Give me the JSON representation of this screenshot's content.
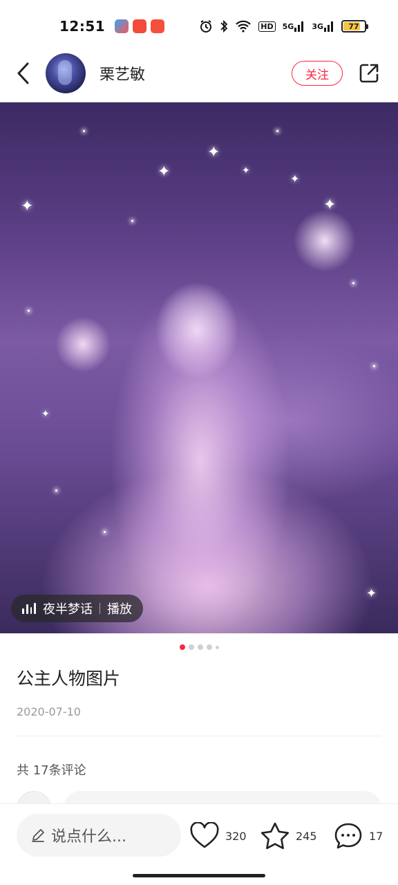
{
  "status_bar": {
    "time": "12:51",
    "network_1": "5G",
    "network_2": "3G",
    "hd_label": "HD",
    "battery_level": "77"
  },
  "header": {
    "author_name": "栗艺敏",
    "follow_label": "关注"
  },
  "media": {
    "music_name": "夜半梦话",
    "play_label": "播放",
    "page_count": 5,
    "active_page": 1
  },
  "note": {
    "title": "公主人物图片",
    "date": "2020-07-10",
    "comment_count_label": "共 17条评论"
  },
  "bottom_bar": {
    "input_placeholder": "说点什么...",
    "like_count": "320",
    "collect_count": "245",
    "comment_count": "17"
  },
  "colors": {
    "accent": "#ff2442",
    "battery": "#f6c342"
  },
  "icons": [
    "back-icon",
    "share-icon",
    "music-bars-icon",
    "pencil-icon",
    "heart-icon",
    "star-icon",
    "comment-bubble-icon",
    "wifi-icon",
    "bluetooth-icon",
    "alarm-icon"
  ]
}
